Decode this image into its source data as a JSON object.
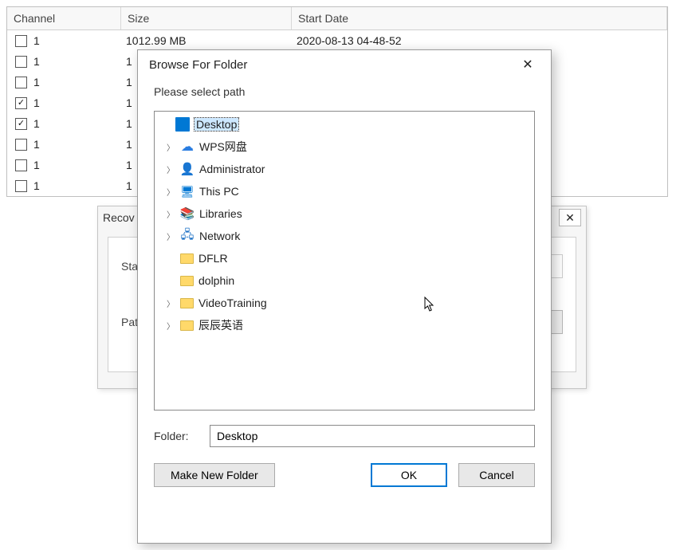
{
  "table": {
    "headers": {
      "channel": "Channel",
      "size": "Size",
      "start": "Start Date"
    },
    "rows": [
      {
        "checked": false,
        "channel": "1",
        "size": "1012.99 MB",
        "start": "2020-08-13 04-48-52"
      },
      {
        "checked": false,
        "channel": "1",
        "size": "1",
        "start": ""
      },
      {
        "checked": false,
        "channel": "1",
        "size": "1",
        "start": ""
      },
      {
        "checked": true,
        "channel": "1",
        "size": "1",
        "start": ""
      },
      {
        "checked": true,
        "channel": "1",
        "size": "1",
        "start": ""
      },
      {
        "checked": false,
        "channel": "1",
        "size": "1",
        "start": ""
      },
      {
        "checked": false,
        "channel": "1",
        "size": "1",
        "start": ""
      },
      {
        "checked": false,
        "channel": "1",
        "size": "1",
        "start": ""
      }
    ]
  },
  "recov_dialog": {
    "title_partial": "Recov",
    "label_start_partial": "Sta",
    "label_path": "Path",
    "browse_label": "..."
  },
  "bff": {
    "title": "Browse For Folder",
    "instruction": "Please select path",
    "tree": {
      "root": {
        "label": "Desktop",
        "selected": true
      },
      "items": [
        {
          "label": "WPS网盘",
          "icon": "cloud",
          "expandable": true
        },
        {
          "label": "Administrator",
          "icon": "user",
          "expandable": true
        },
        {
          "label": "This PC",
          "icon": "pc",
          "expandable": true
        },
        {
          "label": "Libraries",
          "icon": "lib",
          "expandable": true
        },
        {
          "label": "Network",
          "icon": "net",
          "expandable": true
        },
        {
          "label": "DFLR",
          "icon": "folder",
          "expandable": false
        },
        {
          "label": "dolphin",
          "icon": "folder",
          "expandable": false
        },
        {
          "label": "VideoTraining",
          "icon": "folder",
          "expandable": true
        },
        {
          "label": "辰辰英语",
          "icon": "folder",
          "expandable": true
        }
      ]
    },
    "folder_label": "Folder:",
    "folder_value": "Desktop",
    "buttons": {
      "make": "Make New Folder",
      "ok": "OK",
      "cancel": "Cancel"
    }
  }
}
